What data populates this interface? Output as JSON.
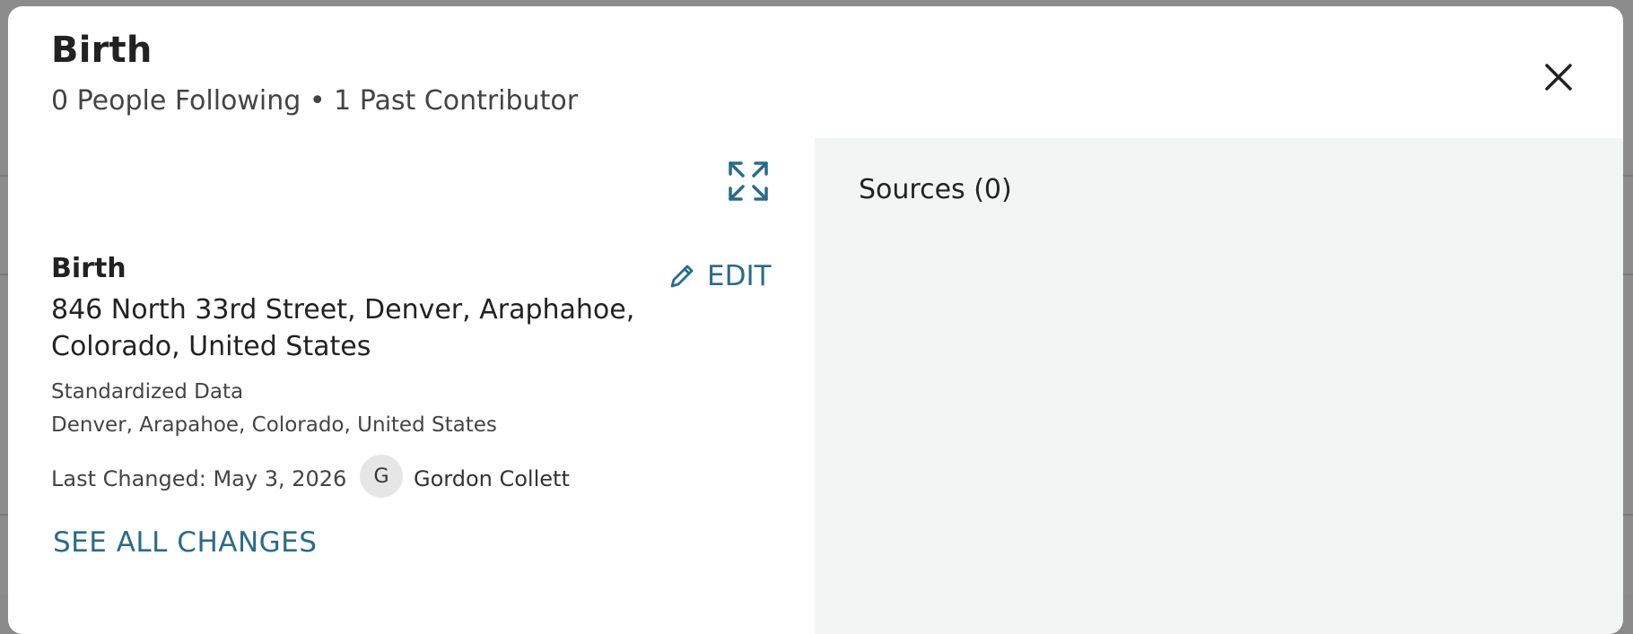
{
  "modal": {
    "title": "Birth",
    "subtitle": "0 People Following • 1 Past Contributor",
    "close_icon": "close-icon"
  },
  "event": {
    "title": "Birth",
    "edit_label": "EDIT",
    "edit_icon": "pencil-icon",
    "expand_icon": "expand-icon",
    "address": "846 North 33rd Street, Denver, Araphahoe, Colorado, United States",
    "standardized_label": "Standardized Data",
    "standardized_value": "Denver, Arapahoe, Colorado, United States",
    "last_changed": "Last Changed: May 3, 2026",
    "contributor": {
      "initial": "G",
      "name": "Gordon Collett"
    },
    "see_all_label": "SEE ALL CHANGES"
  },
  "sources": {
    "heading": "Sources (0)"
  },
  "colors": {
    "accent": "#2a6b8a",
    "right_pane_bg": "#f3f5f4"
  }
}
